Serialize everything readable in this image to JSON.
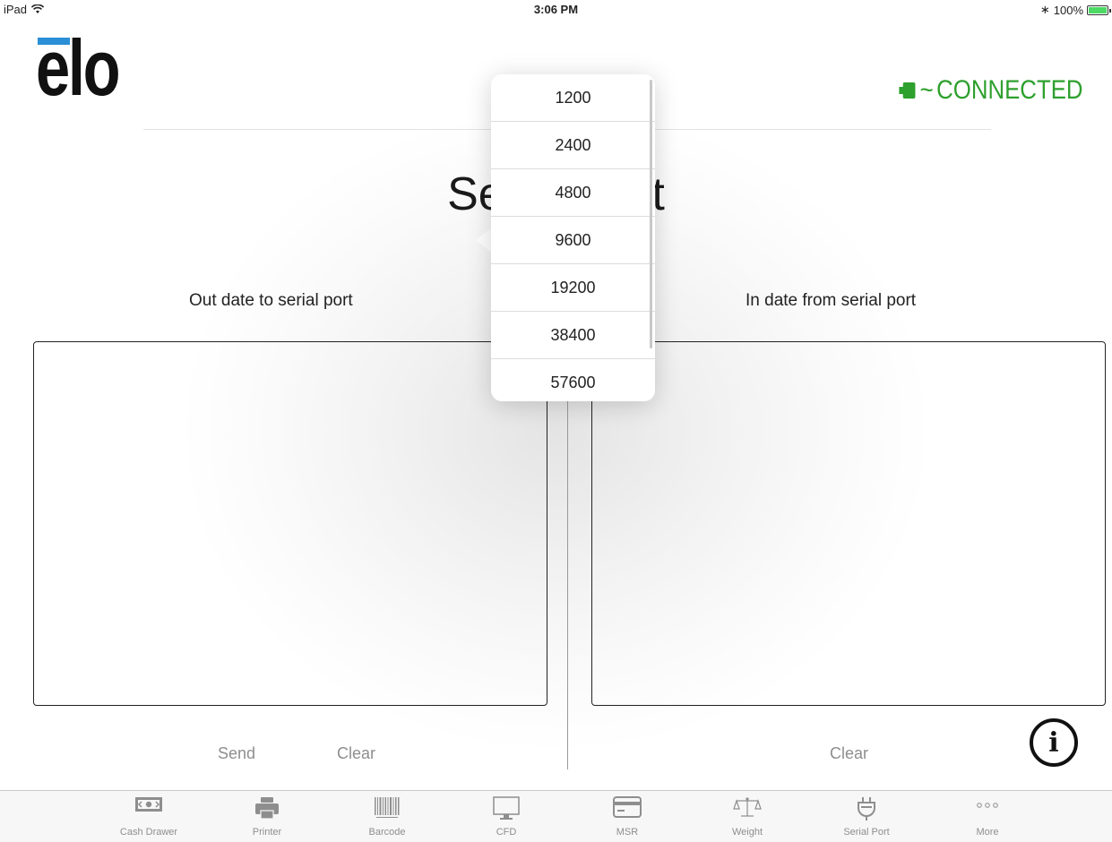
{
  "status_bar": {
    "device": "iPad",
    "time": "3:06 PM",
    "battery": "100%",
    "battery_level": 1.0
  },
  "header": {
    "logo": "elo",
    "connection_status": "CONNECTED",
    "status_color": "#2ea02e",
    "logo_accent": "#2a8fd6"
  },
  "page": {
    "title": "Serial Port",
    "subtitle": "Serial"
  },
  "dropdown": {
    "options": [
      "1200",
      "2400",
      "4800",
      "9600",
      "19200",
      "38400",
      "57600"
    ]
  },
  "left_panel": {
    "label": "Out date to serial port",
    "send_label": "Send",
    "clear_label": "Clear"
  },
  "right_panel": {
    "label": "In date from serial port",
    "clear_label": "Clear"
  },
  "info_icon": "info-icon",
  "tabs": [
    {
      "label": "Cash Drawer",
      "icon": "cash-drawer-icon"
    },
    {
      "label": "Printer",
      "icon": "printer-icon"
    },
    {
      "label": "Barcode",
      "icon": "barcode-icon"
    },
    {
      "label": "CFD",
      "icon": "monitor-icon"
    },
    {
      "label": "MSR",
      "icon": "card-icon"
    },
    {
      "label": "Weight",
      "icon": "scale-icon"
    },
    {
      "label": "Serial Port",
      "icon": "plug-icon"
    },
    {
      "label": "More",
      "icon": "more-icon"
    }
  ]
}
